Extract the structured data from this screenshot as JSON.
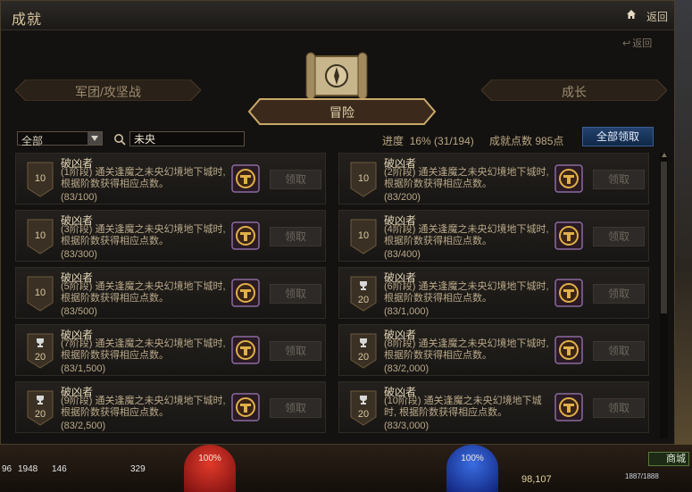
{
  "window": {
    "title": "成就",
    "back_top": "返回",
    "back_sub": "返回"
  },
  "tabs": {
    "left": "军团/攻坚战",
    "center": "冒险",
    "right": "成长"
  },
  "filters": {
    "category": "全部",
    "search_value": "未央"
  },
  "summary": {
    "progress_label": "进度",
    "progress_value": "16% (31/194)",
    "points_label": "成就点数",
    "points_value": "985点",
    "claim_all": "全部领取"
  },
  "achievements": [
    {
      "name": "破凶者",
      "desc": "(1阶段) 通关逢魔之未央幻境地下城时, 根据阶数获得相应点数。",
      "progress": "(83/100)",
      "badge": "10",
      "cup": false,
      "claim": "领取"
    },
    {
      "name": "破凶者",
      "desc": "(2阶段) 通关逢魔之未央幻境地下城时, 根据阶数获得相应点数。",
      "progress": "(83/200)",
      "badge": "10",
      "cup": false,
      "claim": "领取"
    },
    {
      "name": "破凶者",
      "desc": "(3阶段) 通关逢魔之未央幻境地下城时, 根据阶数获得相应点数。",
      "progress": "(83/300)",
      "badge": "10",
      "cup": false,
      "claim": "领取"
    },
    {
      "name": "破凶者",
      "desc": "(4阶段) 通关逢魔之未央幻境地下城时, 根据阶数获得相应点数。",
      "progress": "(83/400)",
      "badge": "10",
      "cup": false,
      "claim": "领取"
    },
    {
      "name": "破凶者",
      "desc": "(5阶段) 通关逢魔之未央幻境地下城时, 根据阶数获得相应点数。",
      "progress": "(83/500)",
      "badge": "10",
      "cup": false,
      "claim": "领取"
    },
    {
      "name": "破凶者",
      "desc": "(6阶段) 通关逢魔之未央幻境地下城时, 根据阶数获得相应点数。",
      "progress": "(83/1,000)",
      "badge": "20",
      "cup": true,
      "claim": "领取"
    },
    {
      "name": "破凶者",
      "desc": "(7阶段) 通关逢魔之未央幻境地下城时, 根据阶数获得相应点数。",
      "progress": "(83/1,500)",
      "badge": "20",
      "cup": true,
      "claim": "领取"
    },
    {
      "name": "破凶者",
      "desc": "(8阶段) 通关逢魔之未央幻境地下城时, 根据阶数获得相应点数。",
      "progress": "(83/2,000)",
      "badge": "20",
      "cup": true,
      "claim": "领取"
    },
    {
      "name": "破凶者",
      "desc": "(9阶段) 通关逢魔之未央幻境地下城时, 根据阶数获得相应点数。",
      "progress": "(83/2,500)",
      "badge": "20",
      "cup": true,
      "claim": "领取"
    },
    {
      "name": "破凶者",
      "desc": "(10阶段) 通关逢魔之未央幻境地下城时, 根据阶数获得相应点数。",
      "progress": "(83/3,000)",
      "badge": "20",
      "cup": true,
      "claim": "领取"
    }
  ],
  "hud": {
    "hp_orb": "100%",
    "mp_orb": "100%",
    "shop": "商城",
    "gold": "98,107",
    "slot1": "96",
    "slot2": "1948",
    "slot3": "146",
    "slot4": "329",
    "hp_bar": "1887/1888"
  }
}
